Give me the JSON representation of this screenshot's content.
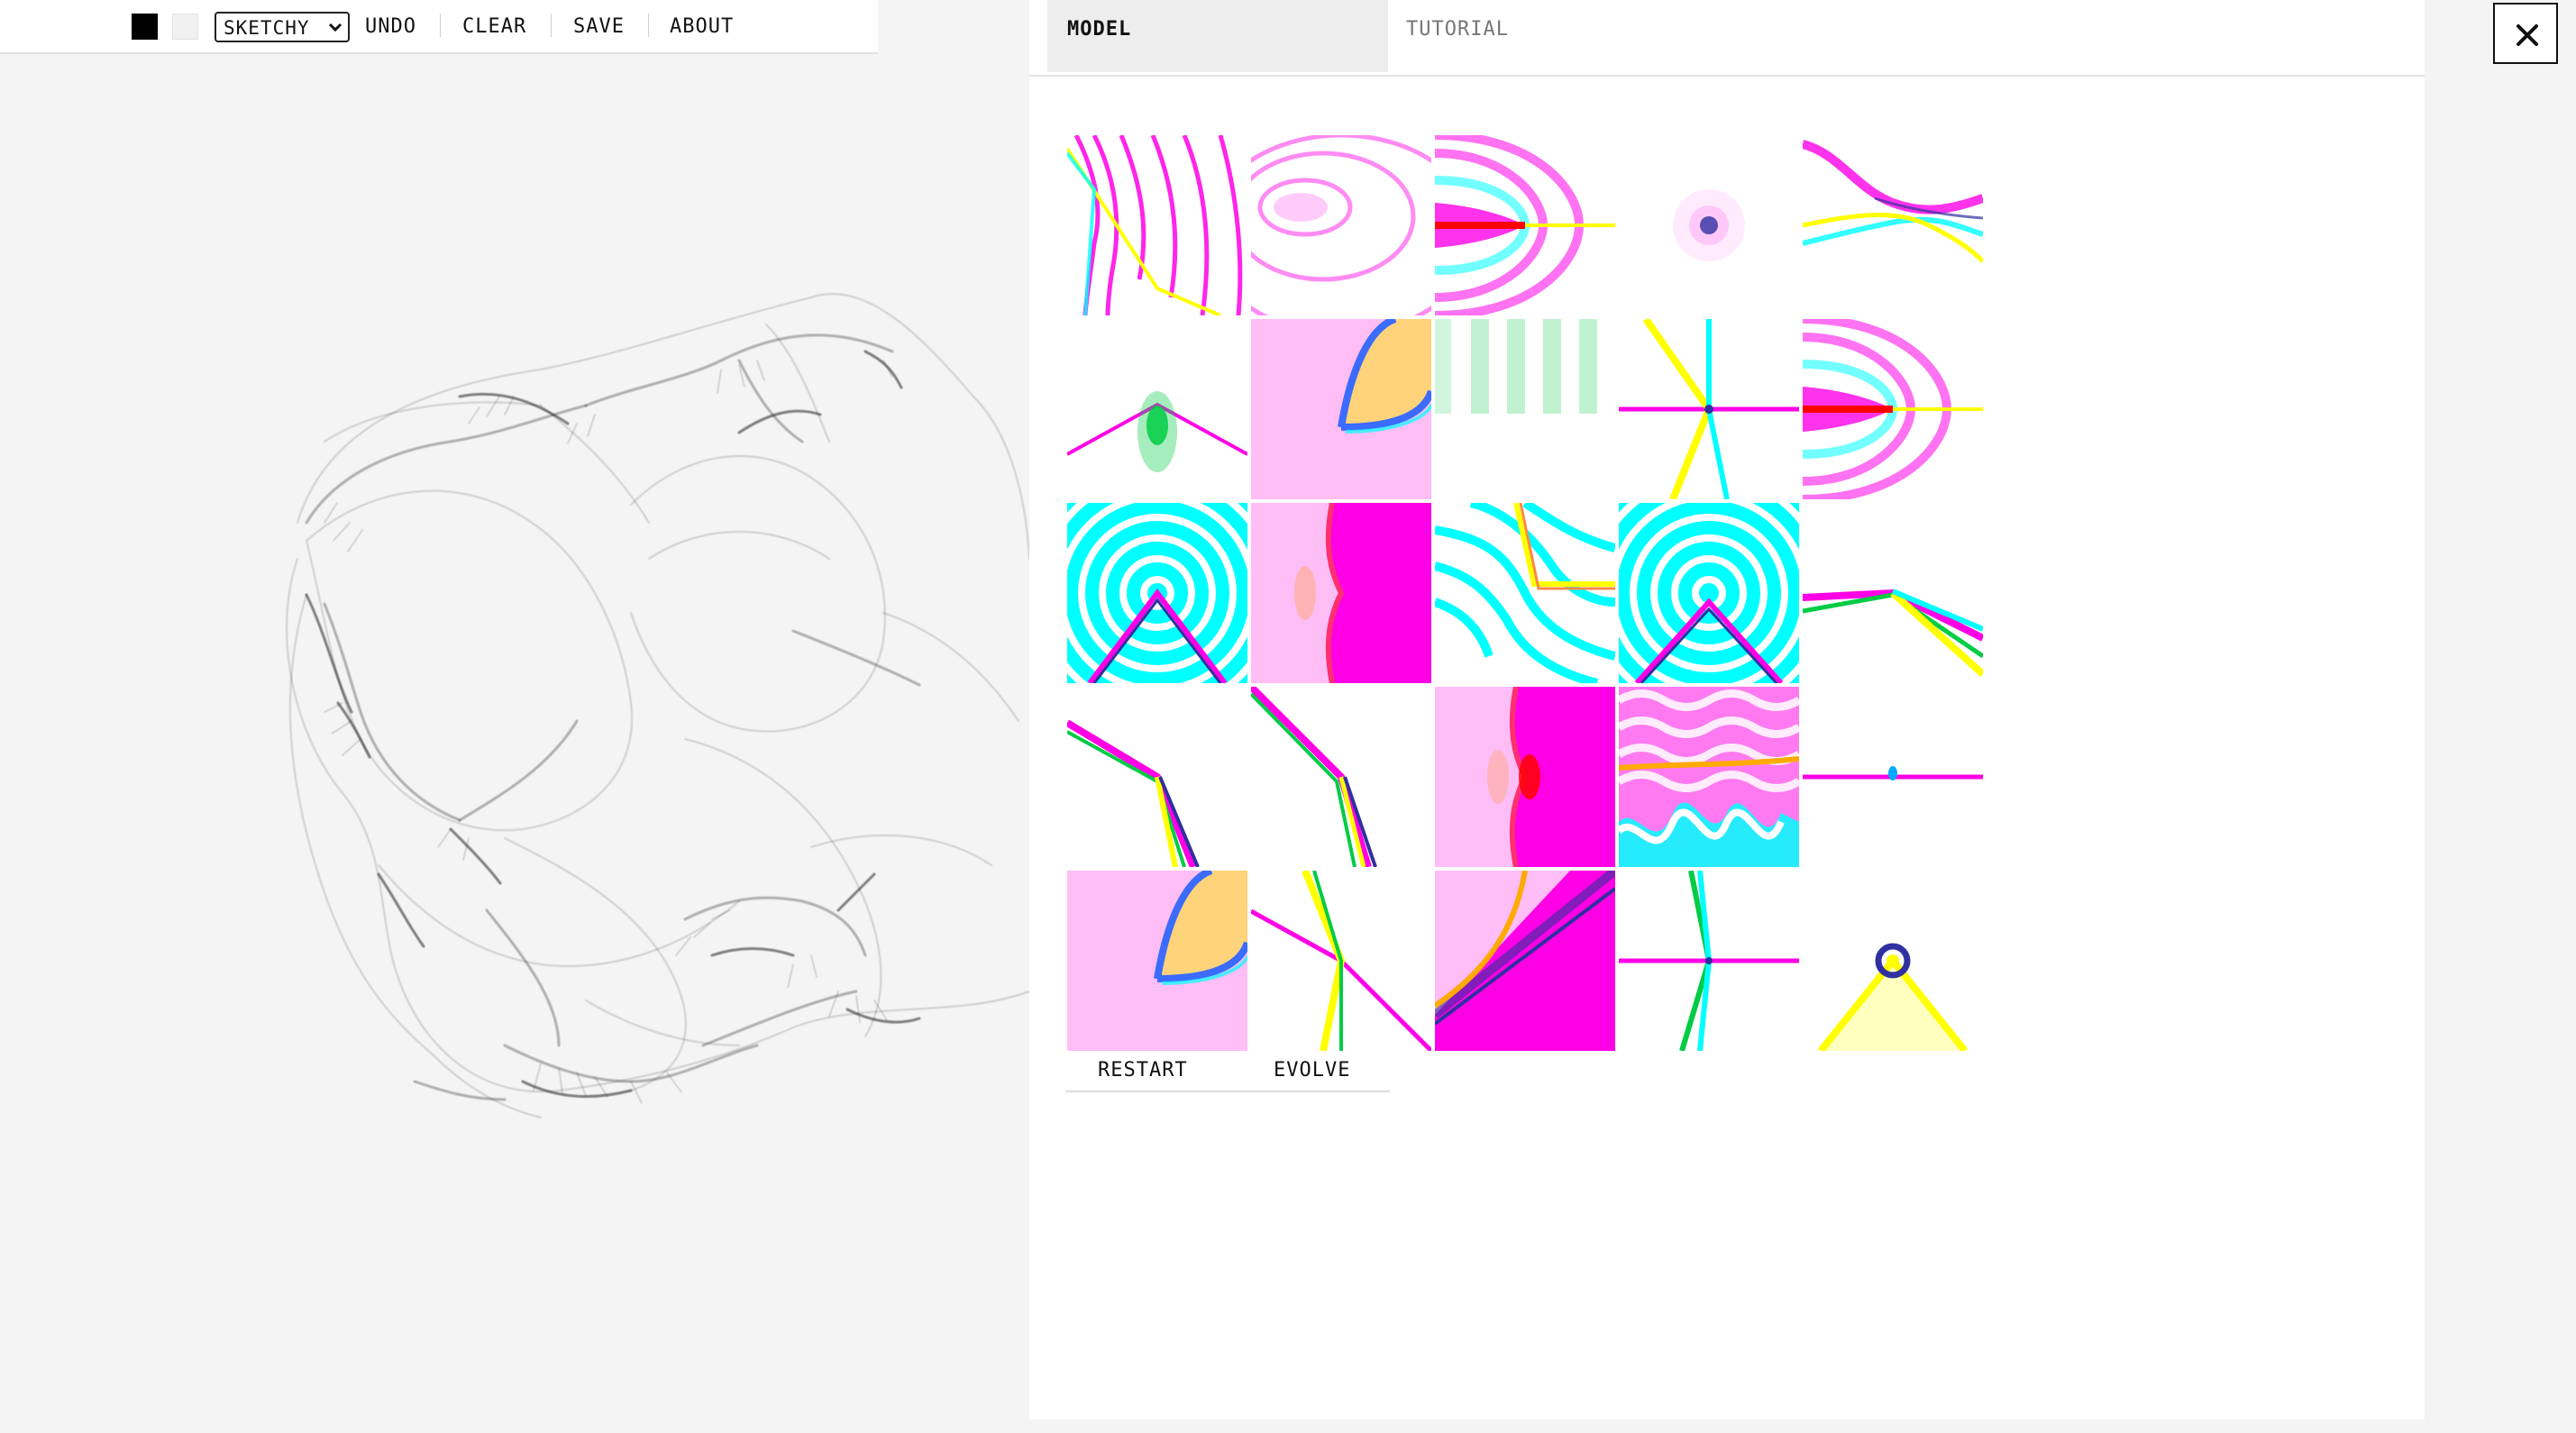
{
  "toolbar": {
    "brush": {
      "selected": "SKETCHY"
    },
    "undo_label": "UNDO",
    "clear_label": "CLEAR",
    "save_label": "SAVE",
    "about_label": "ABOUT",
    "colors": {
      "stroke": "#000000",
      "background": "#f0f0f0"
    }
  },
  "panel": {
    "tabs": [
      {
        "label": "MODEL",
        "active": true
      },
      {
        "label": "TUTORIAL",
        "active": false
      }
    ],
    "restart_label": "RESTART",
    "evolve_label": "EVOLVE",
    "close_icon": "close-icon",
    "tile_palette": [
      "#ff00e6",
      "#00ffff",
      "#ffff00",
      "#0000ff",
      "#ff0000",
      "#00cc44"
    ]
  }
}
